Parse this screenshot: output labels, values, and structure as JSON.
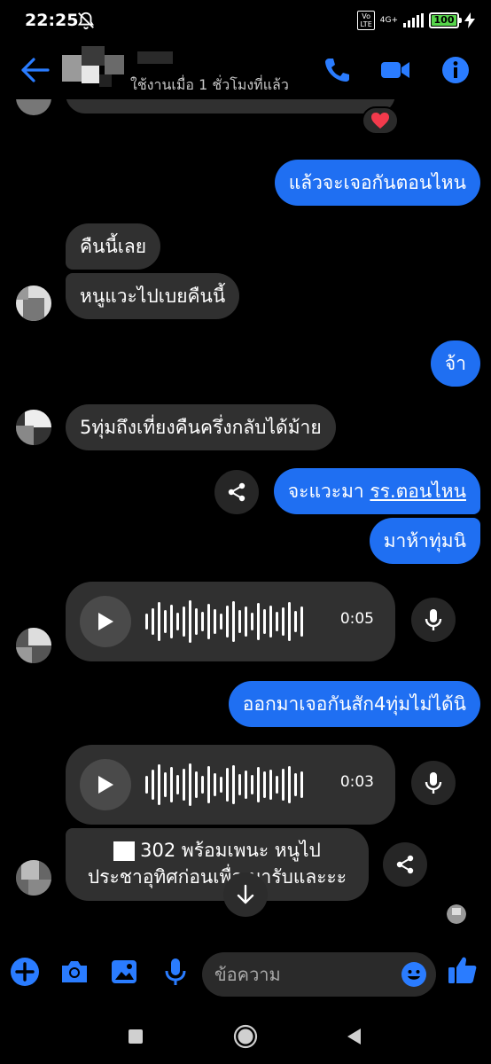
{
  "status_bar": {
    "time": "22:25",
    "volte_top": "Vo",
    "volte_bottom": "LTE",
    "network": "4G+",
    "battery": "100"
  },
  "header": {
    "contact_status": "ใช้งานเมื่อ 1 ชั่วโมงที่แล้ว"
  },
  "colors": {
    "accent": "#1f6ff2",
    "icon_blue": "#2a7cff",
    "incoming_bubble": "#303030"
  },
  "messages": [
    {
      "text": "แล้วจะเจอกันตอนไหน"
    },
    {
      "text": "คืนนี้เลย"
    },
    {
      "text": "หนูแวะไปเบยคืนนี้"
    },
    {
      "text": "จ้า"
    },
    {
      "text": "5ทุ่มถึงเที่ยงคืนครึ่งกลับได้ม้าย"
    },
    {
      "text": "จะแวะมา ",
      "link": "รร.ตอนไหน"
    },
    {
      "text": "มาห้าทุ่มนิ"
    },
    {
      "duration": "0:05"
    },
    {
      "text": "ออกมาเจอกันสัก4ทุ่มไม่ได้นิ"
    },
    {
      "duration": "0:03"
    },
    {
      "line1": "302 พร้อมเพนะ หนูไป",
      "line2": "ประชาอุทิศก่อนเพื่อ    มารับและะะ"
    }
  ],
  "composer": {
    "placeholder": "ข้อความ"
  },
  "icons": [
    "back-arrow-icon",
    "phone-icon",
    "video-camera-icon",
    "info-icon",
    "heart-icon",
    "share-icon",
    "play-icon",
    "microphone-icon",
    "arrow-down-icon",
    "plus-icon",
    "camera-icon",
    "image-icon",
    "emoji-icon",
    "thumbs-up-icon",
    "square-icon",
    "circle-icon",
    "triangle-back-icon"
  ]
}
